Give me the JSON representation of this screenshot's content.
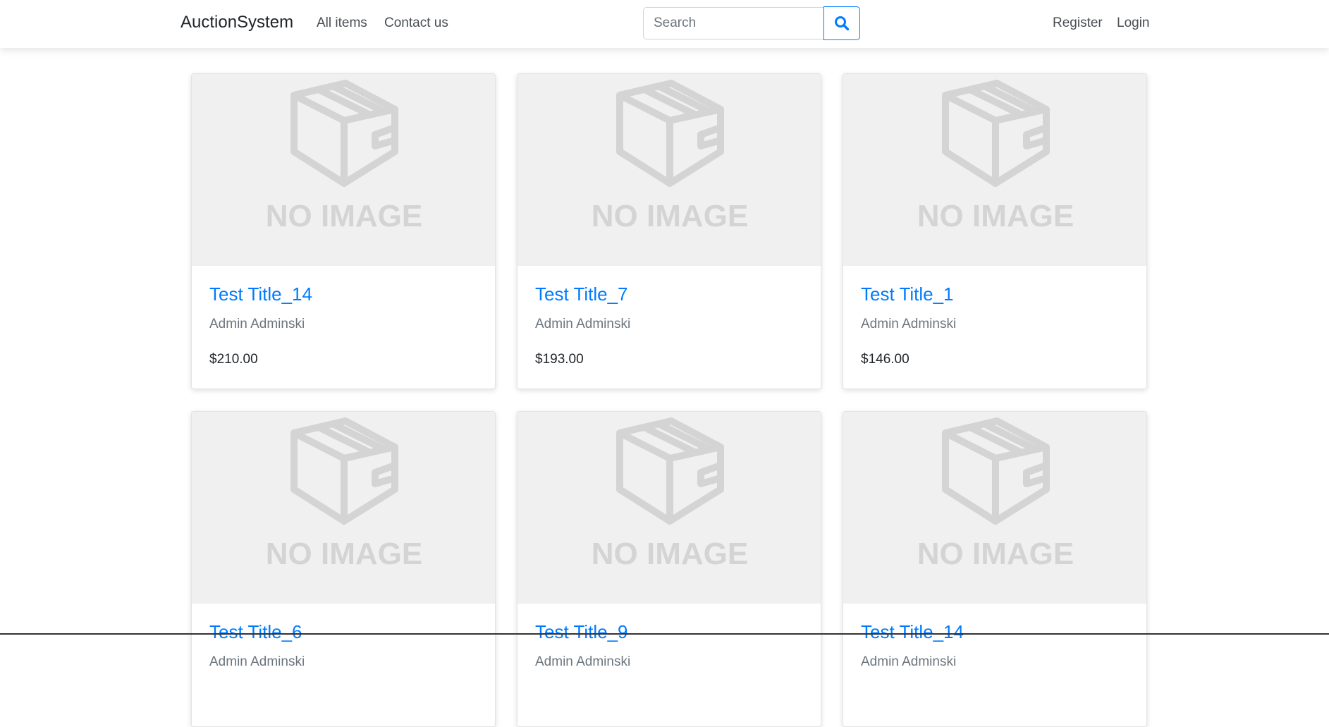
{
  "navbar": {
    "brand": "AuctionSystem",
    "links": [
      {
        "label": "All items"
      },
      {
        "label": "Contact us"
      }
    ],
    "search": {
      "placeholder": "Search",
      "value": "",
      "button_icon": "search-icon"
    },
    "auth": {
      "register": "Register",
      "login": "Login"
    }
  },
  "placeholder_image": {
    "text": "NO IMAGE",
    "icon": "box-icon"
  },
  "colors": {
    "accent": "#007bff",
    "muted": "#6c757d",
    "image_bg": "#f0f0f0",
    "image_fg": "#d4d4d4"
  },
  "items": [
    {
      "title": "Test Title_14",
      "seller": "Admin Adminski",
      "price": "$210.00"
    },
    {
      "title": "Test Title_7",
      "seller": "Admin Adminski",
      "price": "$193.00"
    },
    {
      "title": "Test Title_1",
      "seller": "Admin Adminski",
      "price": "$146.00"
    },
    {
      "title": "Test Title_6",
      "seller": "Admin Adminski",
      "price": ""
    },
    {
      "title": "Test Title_9",
      "seller": "Admin Adminski",
      "price": ""
    },
    {
      "title": "Test Title_14",
      "seller": "Admin Adminski",
      "price": ""
    }
  ]
}
